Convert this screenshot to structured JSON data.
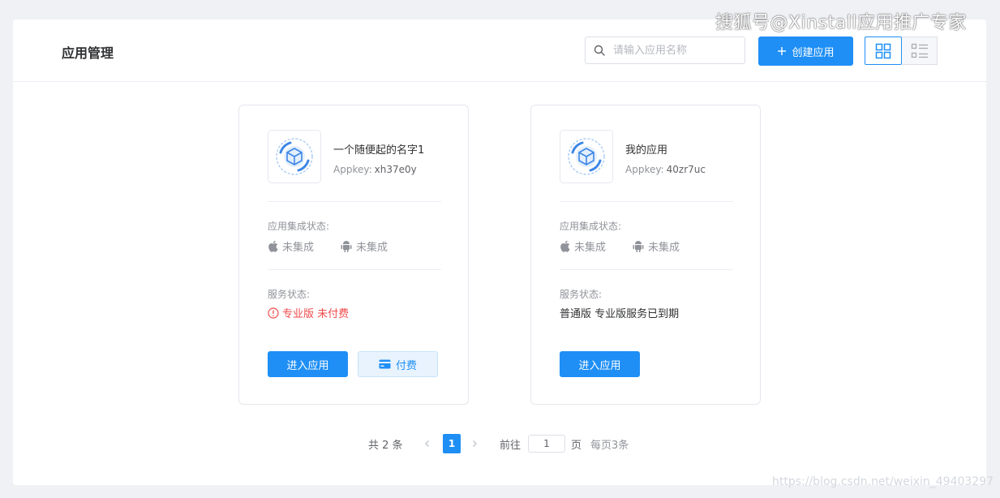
{
  "header": {
    "title": "应用管理",
    "search_placeholder": "请输入应用名称",
    "create_label": "创建应用"
  },
  "watermark": {
    "top": "搜狐号@Xinstall应用推广专家",
    "bottom": "https://blog.csdn.net/weixin_49403297"
  },
  "integration_label": "应用集成状态:",
  "service_label": "服务状态:",
  "appkey_label": "Appkey:",
  "apps": [
    {
      "name": "一个随便起的名字1",
      "appkey": "xh37e0y",
      "ios_status": "未集成",
      "android_status": "未集成",
      "service_status": "专业版 未付费",
      "enter_label": "进入应用",
      "pay_label": "付费"
    },
    {
      "name": "我的应用",
      "appkey": "40zr7uc",
      "ios_status": "未集成",
      "android_status": "未集成",
      "service_status": "普通版 专业版服务已到期",
      "enter_label": "进入应用"
    }
  ],
  "pagination": {
    "total": "共 2 条",
    "current_page": "1",
    "goto_label": "前往",
    "goto_value": "1",
    "page_unit": "页",
    "page_size": "每页3条"
  },
  "colors": {
    "primary": "#1f8ff5",
    "danger": "#f04b4b",
    "text": "#303133",
    "muted": "#909399",
    "background": "#eff1f4"
  },
  "icons": {
    "search": "search-icon",
    "create": "plus-icon",
    "grid_view": "grid-view-icon",
    "list_view": "list-view-icon",
    "app": "cube-icon",
    "ios": "apple-icon",
    "android": "android-icon",
    "alert": "alert-circle-icon",
    "pay": "credit-card-icon"
  }
}
